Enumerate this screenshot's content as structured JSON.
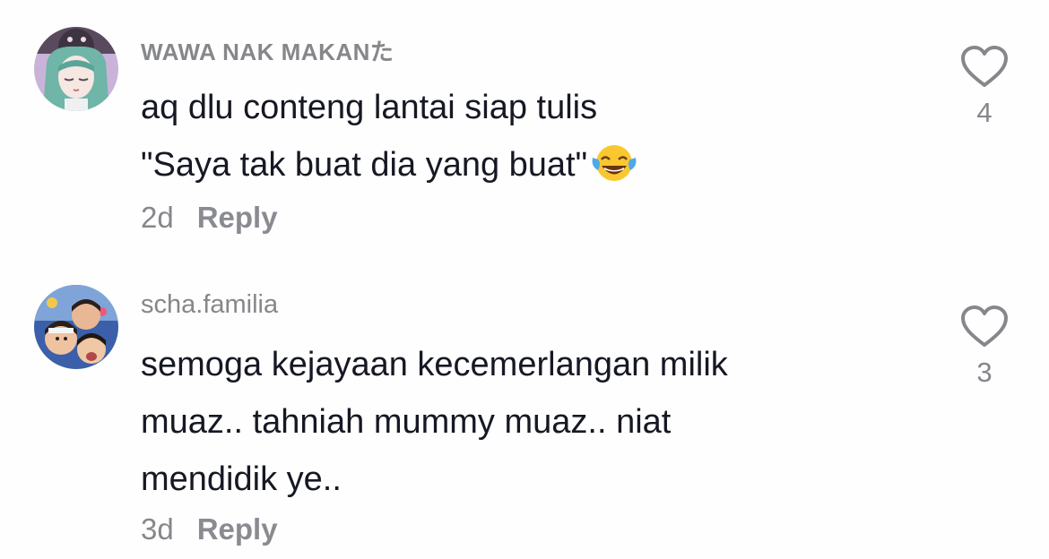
{
  "comments": [
    {
      "username": "WAWA NAK MAKANた",
      "lines": [
        "aq dlu conteng lantai siap tulis",
        "\"Saya tak buat dia yang buat\""
      ],
      "emoji": "face-with-tears-of-joy",
      "time": "2d",
      "reply_label": "Reply",
      "likes": "4"
    },
    {
      "username": "scha.familia",
      "lines": [
        "semoga kejayaan kecemerlangan milik",
        "muaz.. tahniah mummy muaz.. niat",
        "mendidik ye.."
      ],
      "time": "3d",
      "reply_label": "Reply",
      "likes": "3"
    }
  ],
  "colors": {
    "text": "#161823",
    "secondary": "#86878b",
    "background": "#fefefe"
  }
}
